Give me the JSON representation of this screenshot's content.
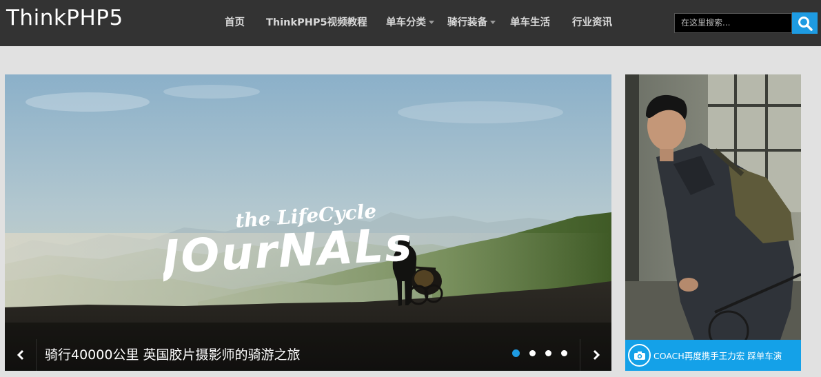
{
  "header": {
    "logo": "ThinkPHP5",
    "nav": [
      {
        "label": "首页",
        "dropdown": false
      },
      {
        "label": "ThinkPHP5视频教程",
        "dropdown": false
      },
      {
        "label": "单车分类",
        "dropdown": true
      },
      {
        "label": "骑行装备",
        "dropdown": true
      },
      {
        "label": "单车生活",
        "dropdown": false
      },
      {
        "label": "行业资讯",
        "dropdown": false
      }
    ],
    "search": {
      "placeholder": "在这里搜索...",
      "icon": "search-icon"
    }
  },
  "slider": {
    "overlay_line1": "the LifeCycle",
    "overlay_line2": "JOurNALs",
    "caption": "骑行40000公里 英国胶片摄影师的骑游之旅",
    "slides": 4,
    "active_slide": 1,
    "prev_icon": "chevron-left-icon",
    "next_icon": "chevron-right-icon"
  },
  "side_ad": {
    "caption": "COACH再度携手王力宏 踩单车演",
    "icon": "camera-icon"
  },
  "colors": {
    "header_bg": "#333333",
    "accent": "#1e9be2",
    "page_bg": "#e1e1e1"
  }
}
